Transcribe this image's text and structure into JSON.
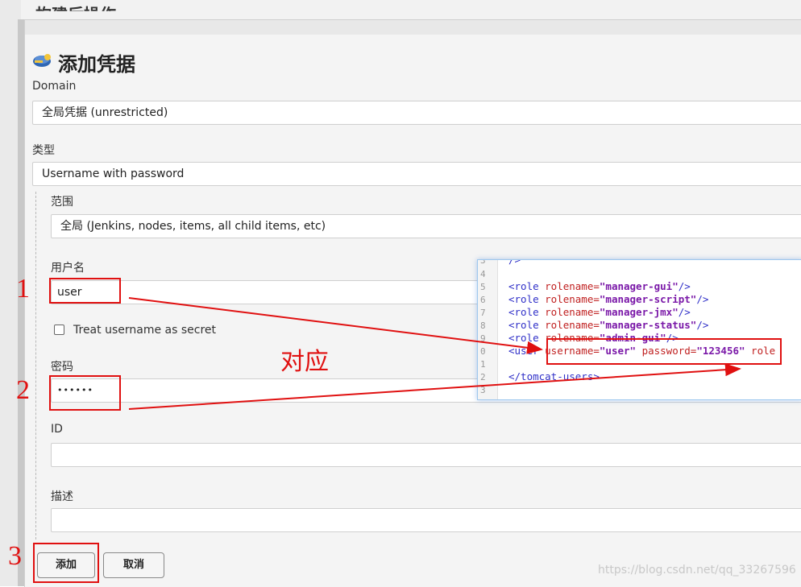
{
  "background": {
    "section_title": "构建后操作"
  },
  "dialog": {
    "title": "添加凭据",
    "domain": {
      "label": "Domain",
      "value": "全局凭据 (unrestricted)"
    },
    "kind": {
      "label": "类型",
      "value": "Username with password"
    },
    "scope": {
      "label": "范围",
      "value": "全局 (Jenkins, nodes, items, all child items, etc)"
    },
    "username": {
      "label": "用户名",
      "value": "user",
      "secret_label": "Treat username as secret",
      "secret_checked": false
    },
    "password": {
      "label": "密码",
      "value": "••••••"
    },
    "id": {
      "label": "ID",
      "value": ""
    },
    "description": {
      "label": "描述",
      "value": ""
    },
    "buttons": {
      "add": "添加",
      "cancel": "取消"
    }
  },
  "code_popup": {
    "line_numbers": [
      "3",
      "4",
      "5",
      "6",
      "7",
      "8",
      "9",
      "0",
      "1",
      "2",
      "3"
    ],
    "lines": {
      "l3": "/>",
      "r1": {
        "tag": "<role ",
        "attr": "rolename=",
        "val": "\"manager-gui\"",
        "end": "/>"
      },
      "r2": {
        "tag": "<role ",
        "attr": "rolename=",
        "val": "\"manager-script\"",
        "end": "/>"
      },
      "r3": {
        "tag": "<role ",
        "attr": "rolename=",
        "val": "\"manager-jmx\"",
        "end": "/>"
      },
      "r4": {
        "tag": "<role ",
        "attr": "rolename=",
        "val": "\"manager-status\"",
        "end": "/>"
      },
      "r5": {
        "tag": "<role ",
        "attr": "rolename=",
        "val": "\"admin-gui\"",
        "end": "/>"
      },
      "user": {
        "tag": "<user ",
        "a1": "username=",
        "v1": "\"user\"",
        "a2": " password=",
        "v2": "\"123456\"",
        "a3": " role"
      },
      "close": "</tomcat-users>"
    }
  },
  "annotations": {
    "n1": "1",
    "n2": "2",
    "n3": "3",
    "match": "对应"
  },
  "watermark": "https://blog.csdn.net/qq_33267596",
  "colors": {
    "annotation": "#e01010",
    "code_tag": "#3030c8",
    "code_attr": "#c02020",
    "code_value": "#7a18a8"
  }
}
